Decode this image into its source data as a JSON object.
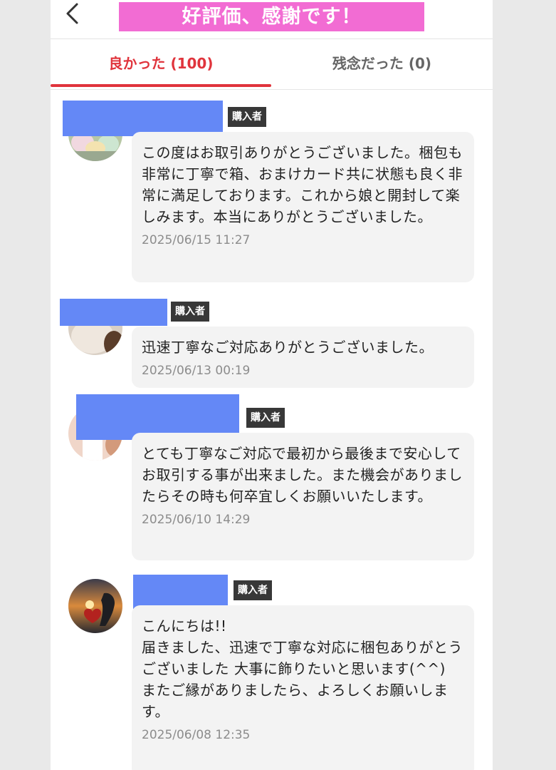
{
  "header": {
    "back_icon": "chevron-left-icon",
    "title": "好評価、感謝です！"
  },
  "tabs": [
    {
      "label": "良かった (100)",
      "active": true
    },
    {
      "label": "残念だった (0)",
      "active": false
    }
  ],
  "colors": {
    "accent": "#e0343c",
    "title_banner": "#f26cd3",
    "name_mask": "#6488f6",
    "badge": "#383838",
    "bubble": "#f3f3f3"
  },
  "reviews": [
    {
      "badge": "購入者",
      "comment": "この度はお取引ありがとうございました。梱包も非常に丁寧で箱、おまけカード共に状態も良く非常に満足しております。これから娘と開封して楽しみます。本当にありがとうございました。",
      "date": "2025/06/15 11:27"
    },
    {
      "badge": "購入者",
      "comment": "迅速丁寧なご対応ありがとうございました。",
      "date": "2025/06/13 00:19"
    },
    {
      "badge": "購入者",
      "comment": "とても丁寧なご対応で最初から最後まで安心してお取引する事が出来ました。また機会がありましたらその時も何卒宜しくお願いいたします。",
      "date": "2025/06/10 14:29"
    },
    {
      "badge": "購入者",
      "comment": "こんにちは!!\n届きました、迅速で丁寧な対応に梱包ありがとうございました 大事に飾りたいと思います(^^)\nまたご縁がありましたら、よろしくお願いします。",
      "date": "2025/06/08 12:35"
    }
  ]
}
